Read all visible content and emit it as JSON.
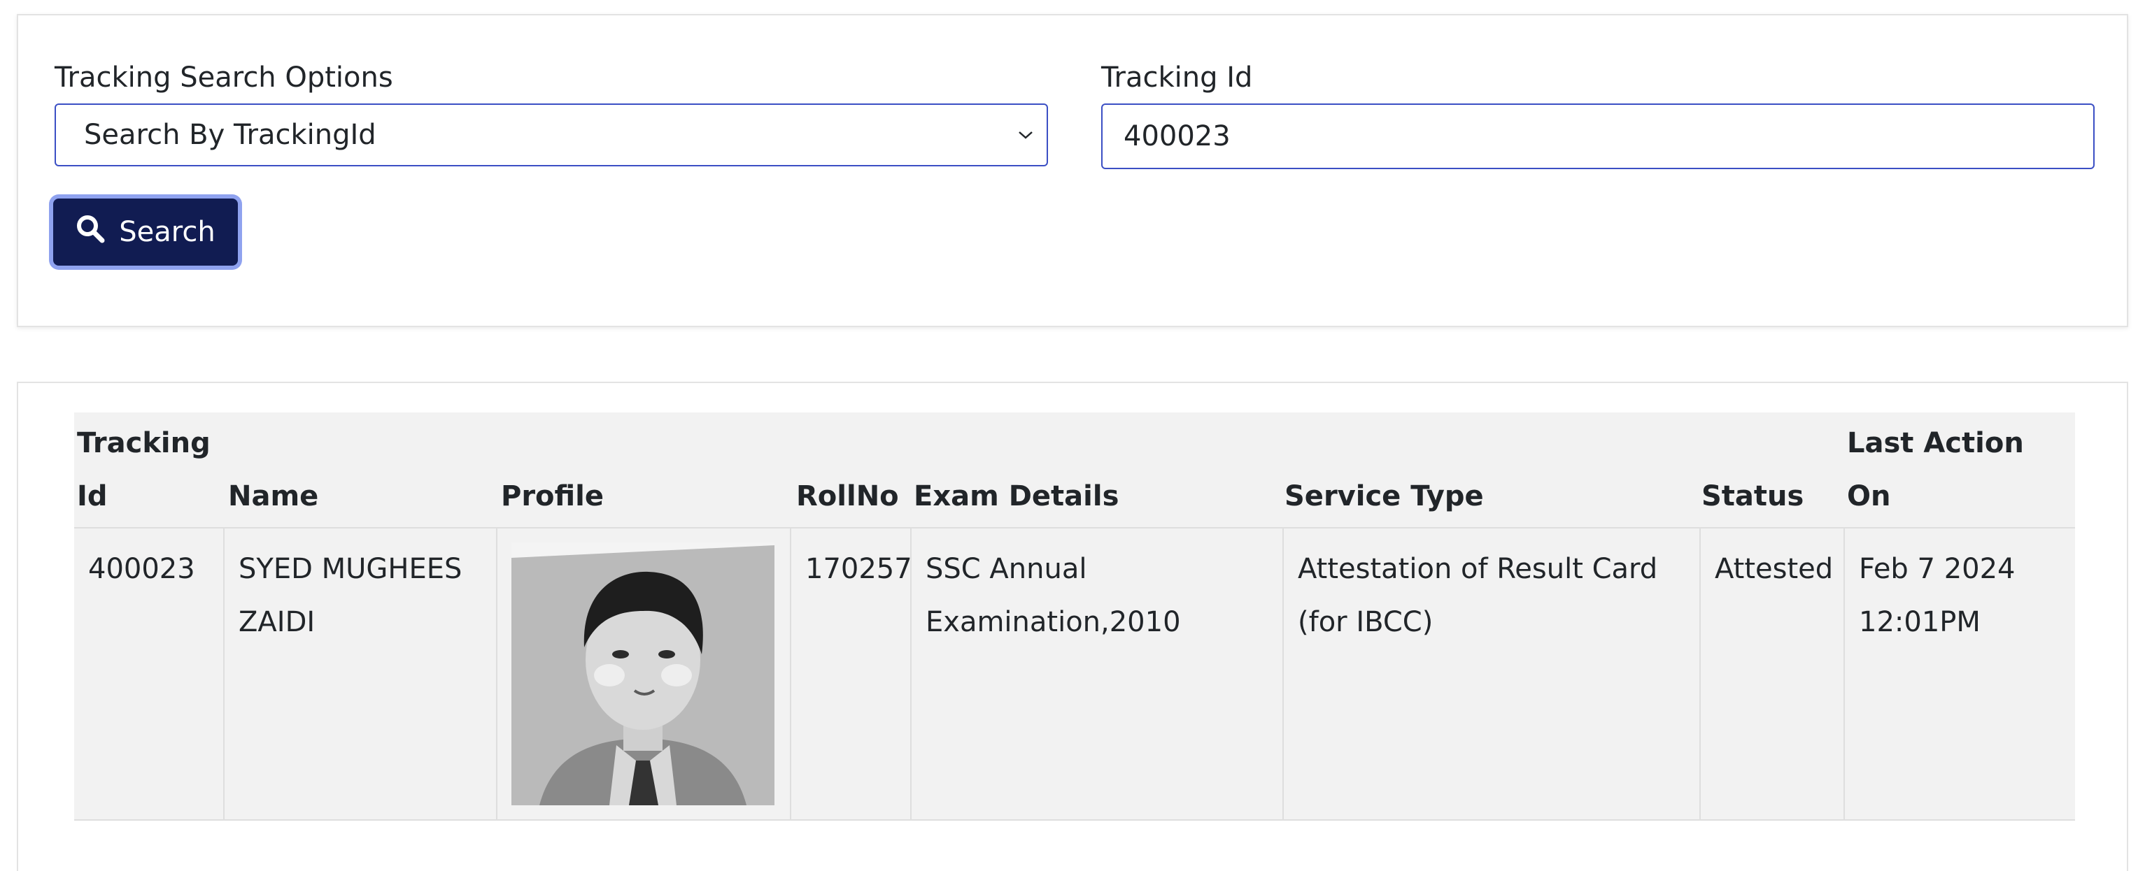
{
  "search_form": {
    "options_label": "Tracking Search Options",
    "selected_option": "Search By TrackingId",
    "tracking_id_label": "Tracking Id",
    "tracking_id_value": "400023",
    "search_button_label": "Search"
  },
  "results_table": {
    "headers": {
      "tracking_id": "Tracking Id",
      "name": "Name",
      "profile": "Profile",
      "roll_no": "RollNo",
      "exam_details": "Exam Details",
      "service_type": "Service Type",
      "status": "Status",
      "last_action_on": "Last Action On"
    },
    "rows": [
      {
        "tracking_id": "400023",
        "name": "SYED MUGHEES ZAIDI",
        "roll_no": "170257",
        "exam_details": "SSC Annual Examination,2010",
        "service_type": "Attestation of Result Card (for IBCC)",
        "status": "Attested",
        "last_action_on": "Feb 7 2024 12:01PM"
      }
    ]
  },
  "colors": {
    "primary_button": "#111c52",
    "input_border": "#3b4fc4",
    "table_background": "#f2f2f2"
  }
}
